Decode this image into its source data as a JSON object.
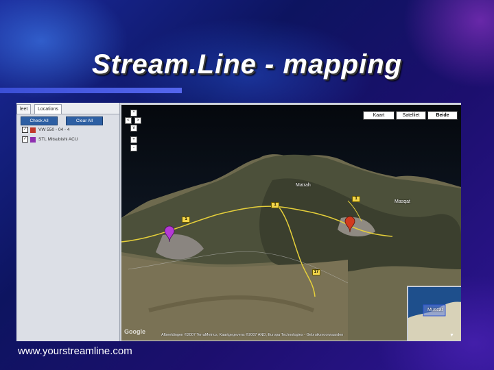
{
  "slide": {
    "title": "Stream.Line - mapping",
    "footer_url": "www.yourstreamline.com"
  },
  "sidebar": {
    "tabs": [
      {
        "label": "leet"
      },
      {
        "label": "Locations"
      }
    ],
    "check_all_label": "Check All",
    "clear_all_label": "Clear All",
    "vehicles": [
      {
        "label": "VW 550 - 04 - 4",
        "color": "#c0392b",
        "checked": true,
        "check_glyph": "✓"
      },
      {
        "label": "STL Mitsubishi ACU",
        "color": "#8e2fb0",
        "checked": true,
        "check_glyph": "✓"
      }
    ]
  },
  "map": {
    "type_buttons": [
      {
        "label": "Kaart"
      },
      {
        "label": "Satelliet"
      },
      {
        "label": "Beide"
      }
    ],
    "place_labels": [
      "Matrah",
      "Masqat"
    ],
    "road_shields": [
      "1",
      "1",
      "1",
      "17"
    ],
    "copyright": "Afbeeldingen ©2007 TerraMetrics, Kaartgegevens ©2007 AND, Europa Technologies - Gebruiksvoorwaarden",
    "logo_text": "Google",
    "overview_label": "Muscat",
    "markers": [
      {
        "vehicle": "STL Mitsubishi ACU",
        "color": "#b53ad6"
      },
      {
        "vehicle": "VW 550 - 04 - 4",
        "color": "#d23a1e"
      }
    ],
    "zoom_control_glyphs": [
      "^",
      "<",
      ">",
      "v",
      "+",
      "-"
    ],
    "overview_toggle_glyph": "▼"
  }
}
